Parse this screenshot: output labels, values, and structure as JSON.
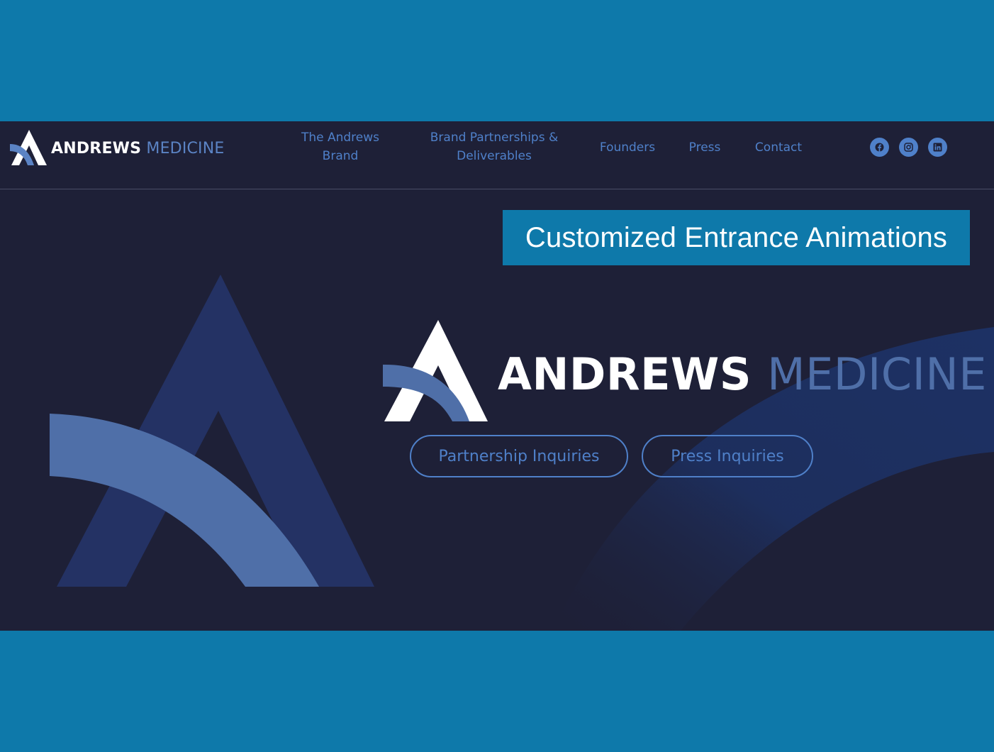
{
  "header": {
    "brand": {
      "word1": "ANDREWS",
      "word2": "MEDICINE",
      "logo_icon": "andrews-a-logo"
    },
    "nav": [
      {
        "label_line1": "The Andrews",
        "label_line2": "Brand"
      },
      {
        "label_line1": "Brand Partnerships &",
        "label_line2": "Deliverables"
      },
      {
        "label": "Founders"
      },
      {
        "label": "Press"
      },
      {
        "label": "Contact"
      }
    ],
    "social": [
      "facebook-icon",
      "instagram-icon",
      "linkedin-icon"
    ]
  },
  "hero": {
    "banner": "Customized Entrance Animations",
    "logo": {
      "word1": "ANDREWS",
      "word2": "MEDICINE"
    },
    "buttons": [
      {
        "label": "Partnership Inquiries"
      },
      {
        "label": "Press Inquiries"
      }
    ]
  },
  "colors": {
    "page_background": "#0e79aa",
    "site_background": "#1e2037",
    "accent_blue": "#4f80c9",
    "banner_background": "#0e79aa",
    "logo_white": "#ffffff",
    "logo_arc": "#4f6fa8"
  }
}
